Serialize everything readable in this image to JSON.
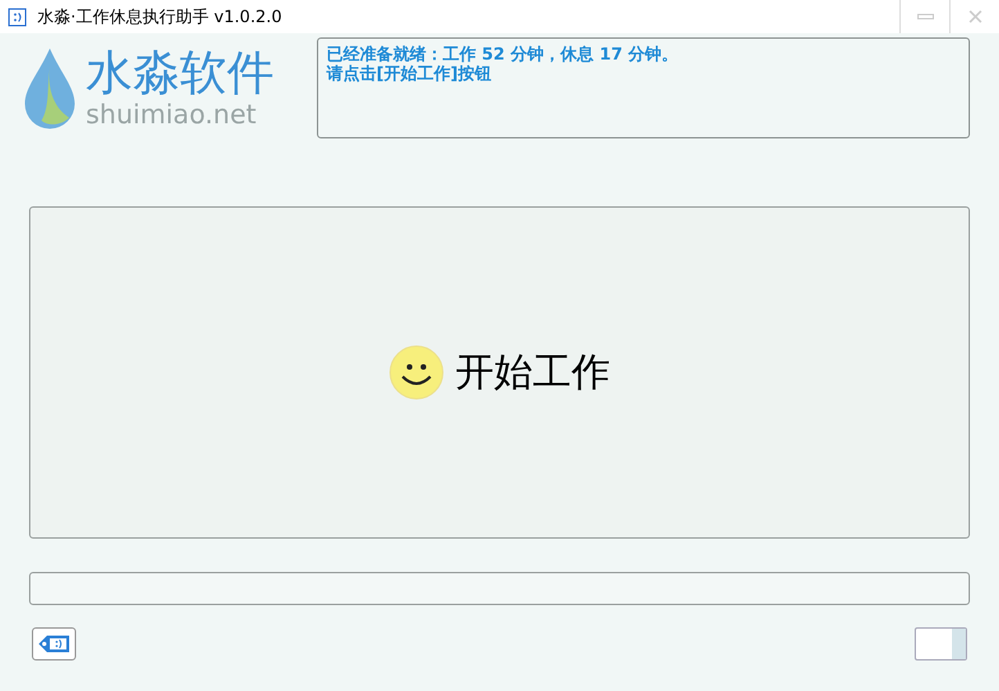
{
  "window": {
    "title": "水淼·工作休息执行助手 v1.0.2.0"
  },
  "logo": {
    "name": "水淼软件",
    "site": "shuimiao.net"
  },
  "message": {
    "lines": [
      "已经准备就绪：工作 52 分钟，休息 17 分钟。",
      "请点击[开始工作]按钮"
    ]
  },
  "start_button": {
    "label": "开始工作"
  }
}
